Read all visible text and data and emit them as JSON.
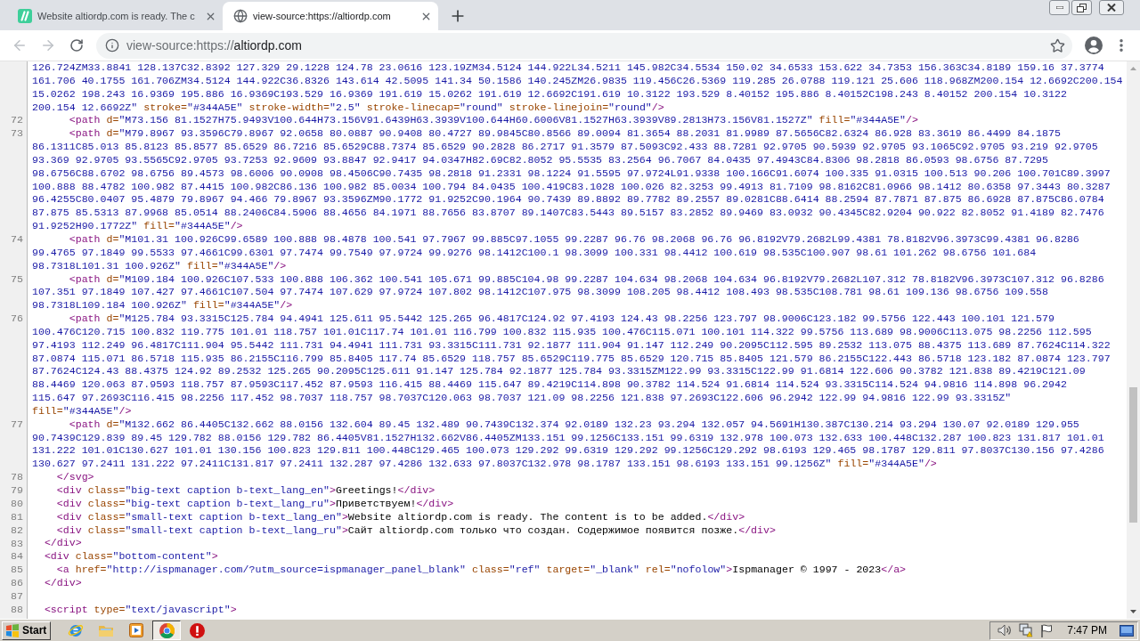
{
  "browser": {
    "tabs": [
      {
        "title": "Website altiordp.com is ready. The c",
        "selected": false
      },
      {
        "title": "view-source:https://altiordp.com",
        "selected": true
      }
    ],
    "toolbar": {
      "back": {
        "disabled": true
      },
      "forward": {
        "disabled": true
      }
    },
    "address": {
      "prefix": "view-source:https://",
      "host": "altiordp.com"
    }
  },
  "source": {
    "lines": [
      {
        "rows": [
          {
            "segments": [
              {
                "kind": "value",
                "text": "126.724ZM33.8841 128.137C32.8392 127.329 29.1228 124.78 23.0616 123.19ZM34.5124 144.922L34.5211 145.982C34.5534 150.02 34.6533 153.622 34.7353 156.363C34.8189 159.16 37.3774"
              }
            ]
          },
          {
            "segments": [
              {
                "kind": "value",
                "text": "161.706 40.1755 161.706ZM34.5124 144.922C36.8326 143.614 42.5095 141.34 50.1586 140.245ZM26.9835 119.456C26.5369 119.285 26.0788 119.121 25.606 118.968ZM200.154 12.6692C200.154"
              }
            ]
          },
          {
            "segments": [
              {
                "kind": "value",
                "text": "15.0262 198.243 16.9369 195.886 16.9369C193.529 16.9369 191.619 15.0262 191.619 12.6692C191.619 10.3122 193.529 8.40152 195.886 8.40152C198.243 8.40152 200.154 10.3122"
              }
            ]
          },
          {
            "segments": [
              {
                "kind": "value",
                "text": "200.154 12.6692Z\""
              },
              {
                "kind": "attr",
                "text": " stroke="
              },
              {
                "kind": "value",
                "text": "\"#344A5E\""
              },
              {
                "kind": "attr",
                "text": " stroke-width="
              },
              {
                "kind": "value",
                "text": "\"2.5\""
              },
              {
                "kind": "attr",
                "text": " stroke-linecap="
              },
              {
                "kind": "value",
                "text": "\"round\""
              },
              {
                "kind": "attr",
                "text": " stroke-linejoin="
              },
              {
                "kind": "value",
                "text": "\"round\""
              },
              {
                "kind": "tag",
                "text": "/>"
              }
            ]
          }
        ]
      },
      {
        "number": "72",
        "rows": [
          {
            "segments": [
              {
                "kind": "tag",
                "text": "      <path"
              },
              {
                "kind": "attr",
                "text": " d="
              },
              {
                "kind": "value",
                "text": "\"M73.156 81.1527H75.9493V100.644H73.156V91.6439H63.3939V100.644H60.6006V81.1527H63.3939V89.2813H73.156V81.1527Z\""
              },
              {
                "kind": "attr",
                "text": " fill="
              },
              {
                "kind": "value",
                "text": "\"#344A5E\""
              },
              {
                "kind": "tag",
                "text": "/>"
              }
            ]
          }
        ]
      },
      {
        "number": "73",
        "rows": [
          {
            "segments": [
              {
                "kind": "tag",
                "text": "      <path"
              },
              {
                "kind": "attr",
                "text": " d="
              },
              {
                "kind": "value",
                "text": "\"M79.8967 93.3596C79.8967 92.0658 80.0887 90.9408 80.4727 89.9845C80.8566 89.0094 81.3654 88.2031 81.9989 87.5656C82.6324 86.928 83.3619 86.4499 84.1875"
              }
            ]
          },
          {
            "segments": [
              {
                "kind": "value",
                "text": "86.1311C85.013 85.8123 85.8577 85.6529 86.7216 85.6529C88.7374 85.6529 90.2828 86.2717 91.3579 87.5093C92.433 88.7281 92.9705 90.5939 92.9705 93.1065C92.9705 93.219 92.9705"
              }
            ]
          },
          {
            "segments": [
              {
                "kind": "value",
                "text": "93.369 92.9705 93.5565C92.9705 93.7253 92.9609 93.8847 92.9417 94.0347H82.69C82.8052 95.5535 83.2564 96.7067 84.0435 97.4943C84.8306 98.2818 86.0593 98.6756 87.7295"
              }
            ]
          },
          {
            "segments": [
              {
                "kind": "value",
                "text": "98.6756C88.6702 98.6756 89.4573 98.6006 90.0908 98.4506C90.7435 98.2818 91.2331 98.1224 91.5595 97.9724L91.9338 100.166C91.6074 100.335 91.0315 100.513 90.206 100.701C89.3997"
              }
            ]
          },
          {
            "segments": [
              {
                "kind": "value",
                "text": "100.888 88.4782 100.982 87.4415 100.982C86.136 100.982 85.0034 100.794 84.0435 100.419C83.1028 100.026 82.3253 99.4913 81.7109 98.8162C81.0966 98.1412 80.6358 97.3443 80.3287"
              }
            ]
          },
          {
            "segments": [
              {
                "kind": "value",
                "text": "96.4255C80.0407 95.4879 79.8967 94.466 79.8967 93.3596ZM90.1772 91.9252C90.1964 90.7439 89.8892 89.7782 89.2557 89.0281C88.6414 88.2594 87.7871 87.875 86.6928 87.875C86.0784"
              }
            ]
          },
          {
            "segments": [
              {
                "kind": "value",
                "text": "87.875 85.5313 87.9968 85.0514 88.2406C84.5906 88.4656 84.1971 88.7656 83.8707 89.1407C83.5443 89.5157 83.2852 89.9469 83.0932 90.4345C82.9204 90.922 82.8052 91.4189 82.7476"
              }
            ]
          },
          {
            "segments": [
              {
                "kind": "value",
                "text": "91.9252H90.1772Z\""
              },
              {
                "kind": "attr",
                "text": " fill="
              },
              {
                "kind": "value",
                "text": "\"#344A5E\""
              },
              {
                "kind": "tag",
                "text": "/>"
              }
            ]
          }
        ]
      },
      {
        "number": "74",
        "rows": [
          {
            "segments": [
              {
                "kind": "tag",
                "text": "      <path"
              },
              {
                "kind": "attr",
                "text": " d="
              },
              {
                "kind": "value",
                "text": "\"M101.31 100.926C99.6589 100.888 98.4878 100.541 97.7967 99.885C97.1055 99.2287 96.76 98.2068 96.76 96.8192V79.2682L99.4381 78.8182V96.3973C99.4381 96.8286"
              }
            ]
          },
          {
            "segments": [
              {
                "kind": "value",
                "text": "99.4765 97.1849 99.5533 97.4661C99.6301 97.7474 99.7549 97.9724 99.9276 98.1412C100.1 98.3099 100.331 98.4412 100.619 98.535C100.907 98.61 101.262 98.6756 101.684"
              }
            ]
          },
          {
            "segments": [
              {
                "kind": "value",
                "text": "98.7318L101.31 100.926Z\""
              },
              {
                "kind": "attr",
                "text": " fill="
              },
              {
                "kind": "value",
                "text": "\"#344A5E\""
              },
              {
                "kind": "tag",
                "text": "/>"
              }
            ]
          }
        ]
      },
      {
        "number": "75",
        "rows": [
          {
            "segments": [
              {
                "kind": "tag",
                "text": "      <path"
              },
              {
                "kind": "attr",
                "text": " d="
              },
              {
                "kind": "value",
                "text": "\"M109.184 100.926C107.533 100.888 106.362 100.541 105.671 99.885C104.98 99.2287 104.634 98.2068 104.634 96.8192V79.2682L107.312 78.8182V96.3973C107.312 96.8286"
              }
            ]
          },
          {
            "segments": [
              {
                "kind": "value",
                "text": "107.351 97.1849 107.427 97.4661C107.504 97.7474 107.629 97.9724 107.802 98.1412C107.975 98.3099 108.205 98.4412 108.493 98.535C108.781 98.61 109.136 98.6756 109.558"
              }
            ]
          },
          {
            "segments": [
              {
                "kind": "value",
                "text": "98.7318L109.184 100.926Z\""
              },
              {
                "kind": "attr",
                "text": " fill="
              },
              {
                "kind": "value",
                "text": "\"#344A5E\""
              },
              {
                "kind": "tag",
                "text": "/>"
              }
            ]
          }
        ]
      },
      {
        "number": "76",
        "rows": [
          {
            "segments": [
              {
                "kind": "tag",
                "text": "      <path"
              },
              {
                "kind": "attr",
                "text": " d="
              },
              {
                "kind": "value",
                "text": "\"M125.784 93.3315C125.784 94.4941 125.611 95.5442 125.265 96.4817C124.92 97.4193 124.43 98.2256 123.797 98.9006C123.182 99.5756 122.443 100.101 121.579"
              }
            ]
          },
          {
            "segments": [
              {
                "kind": "value",
                "text": "100.476C120.715 100.832 119.775 101.01 118.757 101.01C117.74 101.01 116.799 100.832 115.935 100.476C115.071 100.101 114.322 99.5756 113.689 98.9006C113.075 98.2256 112.595"
              }
            ]
          },
          {
            "segments": [
              {
                "kind": "value",
                "text": "97.4193 112.249 96.4817C111.904 95.5442 111.731 94.4941 111.731 93.3315C111.731 92.1877 111.904 91.147 112.249 90.2095C112.595 89.2532 113.075 88.4375 113.689 87.7624C114.322"
              }
            ]
          },
          {
            "segments": [
              {
                "kind": "value",
                "text": "87.0874 115.071 86.5718 115.935 86.2155C116.799 85.8405 117.74 85.6529 118.757 85.6529C119.775 85.6529 120.715 85.8405 121.579 86.2155C122.443 86.5718 123.182 87.0874 123.797"
              }
            ]
          },
          {
            "segments": [
              {
                "kind": "value",
                "text": "87.7624C124.43 88.4375 124.92 89.2532 125.265 90.2095C125.611 91.147 125.784 92.1877 125.784 93.3315ZM122.99 93.3315C122.99 91.6814 122.606 90.3782 121.838 89.4219C121.09"
              }
            ]
          },
          {
            "segments": [
              {
                "kind": "value",
                "text": "88.4469 120.063 87.9593 118.757 87.9593C117.452 87.9593 116.415 88.4469 115.647 89.4219C114.898 90.3782 114.524 91.6814 114.524 93.3315C114.524 94.9816 114.898 96.2942"
              }
            ]
          },
          {
            "segments": [
              {
                "kind": "value",
                "text": "115.647 97.2693C116.415 98.2256 117.452 98.7037 118.757 98.7037C120.063 98.7037 121.09 98.2256 121.838 97.2693C122.606 96.2942 122.99 94.9816 122.99 93.3315Z\""
              }
            ]
          },
          {
            "segments": [
              {
                "kind": "attr",
                "text": "fill="
              },
              {
                "kind": "value",
                "text": "\"#344A5E\""
              },
              {
                "kind": "tag",
                "text": "/>"
              }
            ]
          }
        ]
      },
      {
        "number": "77",
        "rows": [
          {
            "segments": [
              {
                "kind": "tag",
                "text": "      <path"
              },
              {
                "kind": "attr",
                "text": " d="
              },
              {
                "kind": "value",
                "text": "\"M132.662 86.4405C132.662 88.0156 132.604 89.45 132.489 90.7439C132.374 92.0189 132.23 93.294 132.057 94.5691H130.387C130.214 93.294 130.07 92.0189 129.955"
              }
            ]
          },
          {
            "segments": [
              {
                "kind": "value",
                "text": "90.7439C129.839 89.45 129.782 88.0156 129.782 86.4405V81.1527H132.662V86.4405ZM133.151 99.1256C133.151 99.6319 132.978 100.073 132.633 100.448C132.287 100.823 131.817 101.01"
              }
            ]
          },
          {
            "segments": [
              {
                "kind": "value",
                "text": "131.222 101.01C130.627 101.01 130.156 100.823 129.811 100.448C129.465 100.073 129.292 99.6319 129.292 99.1256C129.292 98.6193 129.465 98.1787 129.811 97.8037C130.156 97.4286"
              }
            ]
          },
          {
            "segments": [
              {
                "kind": "value",
                "text": "130.627 97.2411 131.222 97.2411C131.817 97.2411 132.287 97.4286 132.633 97.8037C132.978 98.1787 133.151 98.6193 133.151 99.1256Z\""
              },
              {
                "kind": "attr",
                "text": " fill="
              },
              {
                "kind": "value",
                "text": "\"#344A5E\""
              },
              {
                "kind": "tag",
                "text": "/>"
              }
            ]
          }
        ]
      },
      {
        "number": "78",
        "rows": [
          {
            "segments": [
              {
                "kind": "tag",
                "text": "    </svg>"
              }
            ]
          }
        ]
      },
      {
        "number": "79",
        "rows": [
          {
            "segments": [
              {
                "kind": "tag",
                "text": "    <div"
              },
              {
                "kind": "attr",
                "text": " class="
              },
              {
                "kind": "value",
                "text": "\"big-text caption b-text_lang_en\""
              },
              {
                "kind": "tag",
                "text": ">"
              },
              {
                "kind": "text",
                "text": "Greetings!"
              },
              {
                "kind": "tag",
                "text": "</div>"
              }
            ]
          }
        ]
      },
      {
        "number": "80",
        "rows": [
          {
            "segments": [
              {
                "kind": "tag",
                "text": "    <div"
              },
              {
                "kind": "attr",
                "text": " class="
              },
              {
                "kind": "value",
                "text": "\"big-text caption b-text_lang_ru\""
              },
              {
                "kind": "tag",
                "text": ">"
              },
              {
                "kind": "text",
                "text": "Приветствуем!"
              },
              {
                "kind": "tag",
                "text": "</div>"
              }
            ]
          }
        ]
      },
      {
        "number": "81",
        "rows": [
          {
            "segments": [
              {
                "kind": "tag",
                "text": "    <div"
              },
              {
                "kind": "attr",
                "text": " class="
              },
              {
                "kind": "value",
                "text": "\"small-text caption b-text_lang_en\""
              },
              {
                "kind": "tag",
                "text": ">"
              },
              {
                "kind": "text",
                "text": "Website altiordp.com is ready. The content is to be added."
              },
              {
                "kind": "tag",
                "text": "</div>"
              }
            ]
          }
        ]
      },
      {
        "number": "82",
        "rows": [
          {
            "segments": [
              {
                "kind": "tag",
                "text": "    <div"
              },
              {
                "kind": "attr",
                "text": " class="
              },
              {
                "kind": "value",
                "text": "\"small-text caption b-text_lang_ru\""
              },
              {
                "kind": "tag",
                "text": ">"
              },
              {
                "kind": "text",
                "text": "Сайт altiordp.com только что создан. Содержимое появится позже."
              },
              {
                "kind": "tag",
                "text": "</div>"
              }
            ]
          }
        ]
      },
      {
        "number": "83",
        "rows": [
          {
            "segments": [
              {
                "kind": "tag",
                "text": "  </div>"
              }
            ]
          }
        ]
      },
      {
        "number": "84",
        "rows": [
          {
            "segments": [
              {
                "kind": "tag",
                "text": "  <div"
              },
              {
                "kind": "attr",
                "text": " class="
              },
              {
                "kind": "value",
                "text": "\"bottom-content\""
              },
              {
                "kind": "tag",
                "text": ">"
              }
            ]
          }
        ]
      },
      {
        "number": "85",
        "rows": [
          {
            "segments": [
              {
                "kind": "tag",
                "text": "    <a"
              },
              {
                "kind": "attr",
                "text": " href="
              },
              {
                "kind": "value",
                "text": "\"http://ispmanager.com/?utm_source=ispmanager_panel_blank\""
              },
              {
                "kind": "attr",
                "text": " class="
              },
              {
                "kind": "value",
                "text": "\"ref\""
              },
              {
                "kind": "attr",
                "text": " target="
              },
              {
                "kind": "value",
                "text": "\"_blank\""
              },
              {
                "kind": "attr",
                "text": " rel="
              },
              {
                "kind": "value",
                "text": "\"nofolow\""
              },
              {
                "kind": "tag",
                "text": ">"
              },
              {
                "kind": "text",
                "text": "Ispmanager © 1997 - 2023"
              },
              {
                "kind": "tag",
                "text": "</a>"
              }
            ]
          }
        ]
      },
      {
        "number": "86",
        "rows": [
          {
            "segments": [
              {
                "kind": "tag",
                "text": "  </div>"
              }
            ]
          }
        ]
      },
      {
        "number": "87"
      },
      {
        "number": "88",
        "rows": [
          {
            "segments": [
              {
                "kind": "tag",
                "text": "  <script"
              },
              {
                "kind": "attr",
                "text": " type="
              },
              {
                "kind": "value",
                "text": "\"text/javascript\""
              },
              {
                "kind": "tag",
                "text": ">"
              }
            ]
          }
        ]
      }
    ]
  },
  "taskbar": {
    "start": "Start",
    "apps": [
      {
        "selected": false
      },
      {
        "selected": false
      },
      {
        "selected": false
      },
      {
        "selected": true
      },
      {
        "selected": false
      }
    ],
    "clock": "7:47 PM"
  }
}
